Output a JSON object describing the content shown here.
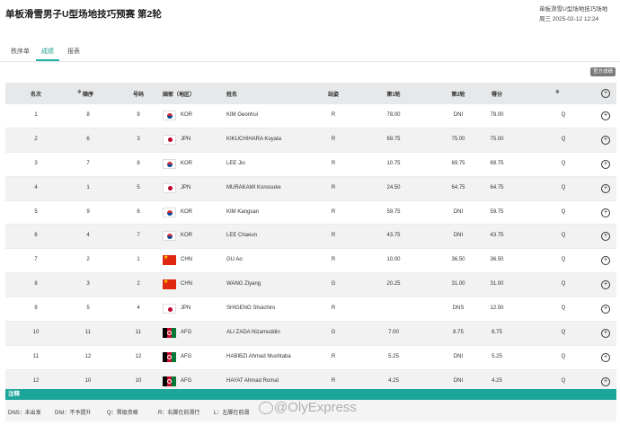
{
  "page": {
    "title": "单板滑雪男子U型场地技巧预赛 第2轮",
    "venue": "单板滑雪U型场地技巧场地",
    "datetime": "周三 2025-02-12 12:24"
  },
  "tabs": [
    {
      "label": "秩序单"
    },
    {
      "label": "成绩"
    },
    {
      "label": "报表"
    }
  ],
  "actions": {
    "official_report": "官方成绩"
  },
  "table": {
    "headers": {
      "rank": "名次",
      "bib_order": "顺序",
      "bib": "号码",
      "nation": "国家（地区）",
      "name": "姓名",
      "stance": "站姿",
      "run1": "第1轮",
      "run2": "第2轮",
      "best": "得分"
    },
    "rows": [
      {
        "rank": "1",
        "order": "8",
        "bib": "9",
        "nat": "KOR",
        "flag": "kor",
        "name": "KIM Geonhui",
        "stance": "R",
        "run1": "78.00",
        "run2": "DNI",
        "best": "78.00",
        "q": "Q"
      },
      {
        "rank": "2",
        "order": "6",
        "bib": "3",
        "nat": "JPN",
        "flag": "jpn",
        "name": "KIKUCHIHARA Koyata",
        "stance": "R",
        "run1": "69.75",
        "run2": "75.00",
        "best": "75.00",
        "q": "Q"
      },
      {
        "rank": "3",
        "order": "7",
        "bib": "8",
        "nat": "KOR",
        "flag": "kor",
        "name": "LEE Jio",
        "stance": "R",
        "run1": "10.75",
        "run2": "69.75",
        "best": "69.75",
        "q": "Q"
      },
      {
        "rank": "4",
        "order": "1",
        "bib": "5",
        "nat": "JPN",
        "flag": "jpn",
        "name": "MURAKAMI Konosuke",
        "stance": "R",
        "run1": "24.50",
        "run2": "64.75",
        "best": "64.75",
        "q": "Q"
      },
      {
        "rank": "5",
        "order": "9",
        "bib": "6",
        "nat": "KOR",
        "flag": "kor",
        "name": "KIM Kangsan",
        "stance": "R",
        "run1": "59.75",
        "run2": "DNI",
        "best": "59.75",
        "q": "Q"
      },
      {
        "rank": "6",
        "order": "4",
        "bib": "7",
        "nat": "KOR",
        "flag": "kor",
        "name": "LEE Chaeun",
        "stance": "R",
        "run1": "43.75",
        "run2": "DNI",
        "best": "43.75",
        "q": "Q"
      },
      {
        "rank": "7",
        "order": "2",
        "bib": "1",
        "nat": "CHN",
        "flag": "chn",
        "name": "GU Ao",
        "stance": "R",
        "run1": "10.00",
        "run2": "36.50",
        "best": "36.50",
        "q": "Q"
      },
      {
        "rank": "8",
        "order": "3",
        "bib": "2",
        "nat": "CHN",
        "flag": "chn",
        "name": "WANG Ziyang",
        "stance": "G",
        "run1": "20.25",
        "run2": "31.00",
        "best": "31.00",
        "q": "Q"
      },
      {
        "rank": "9",
        "order": "5",
        "bib": "4",
        "nat": "JPN",
        "flag": "jpn",
        "name": "SHIGENO Shuichiro",
        "stance": "R",
        "run1": "",
        "run2": "DNS",
        "best": "12.50",
        "q": "Q"
      },
      {
        "rank": "10",
        "order": "11",
        "bib": "11",
        "nat": "AFG",
        "flag": "afg",
        "name": "ALI ZADA Nizamuddin",
        "stance": "G",
        "run1": "7.00",
        "run2": "8.75",
        "best": "8.75",
        "q": "Q"
      },
      {
        "rank": "11",
        "order": "12",
        "bib": "12",
        "nat": "AFG",
        "flag": "afg",
        "name": "HABIBZI Ahmad Mushtaba",
        "stance": "R",
        "run1": "5.25",
        "run2": "DNI",
        "best": "5.25",
        "q": "Q"
      },
      {
        "rank": "12",
        "order": "10",
        "bib": "10",
        "nat": "AFG",
        "flag": "afg",
        "name": "HAYAT Ahmad Romal",
        "stance": "R",
        "run1": "4.25",
        "run2": "DNI",
        "best": "4.25",
        "q": "Q"
      }
    ]
  },
  "notes": {
    "title": "注释",
    "items": [
      "DNS：未出发",
      "DNI：不予提升",
      "Q：晋级资格",
      "R：右脚在前滑行",
      "L：左脚在前滑"
    ]
  },
  "watermark": "@OlyExpress"
}
